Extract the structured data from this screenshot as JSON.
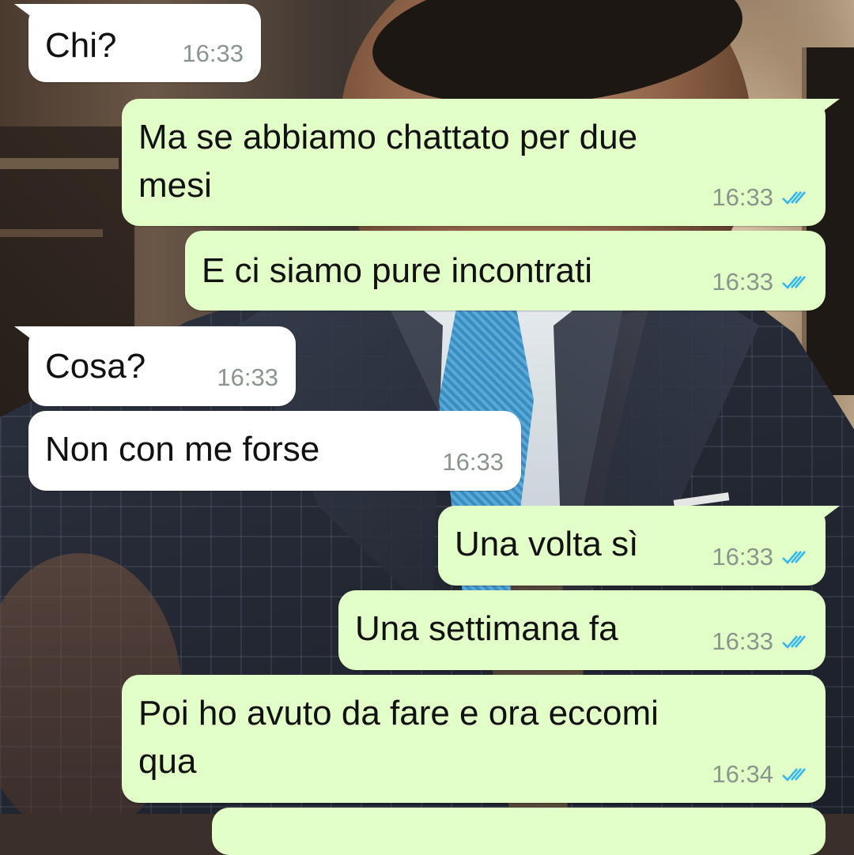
{
  "chat": {
    "messages": [
      {
        "direction": "incoming",
        "text": "Chi?",
        "time": "16:33"
      },
      {
        "direction": "outgoing",
        "text": "Ma se abbiamo chattato per due\nmesi",
        "time": "16:33",
        "status": "read-double-check-icon"
      },
      {
        "direction": "outgoing",
        "text": "E ci siamo pure incontrati",
        "time": "16:33",
        "status": "read-double-check-icon"
      },
      {
        "direction": "incoming",
        "text": "Cosa?",
        "time": "16:33"
      },
      {
        "direction": "incoming",
        "text": "Non con me forse",
        "time": "16:33"
      },
      {
        "direction": "outgoing",
        "text": "Una volta sì",
        "time": "16:33",
        "status": "read-double-check-icon"
      },
      {
        "direction": "outgoing",
        "text": "Una settimana fa",
        "time": "16:33",
        "status": "read-double-check-icon"
      },
      {
        "direction": "outgoing",
        "text": "Poi ho avuto da fare e ora eccomi\nqua",
        "time": "16:34",
        "status": "read-double-check-icon"
      }
    ]
  },
  "colors": {
    "incoming_bubble": "#ffffff",
    "outgoing_bubble": "#e2ffc8",
    "timestamp": "#8a968d",
    "read_ticks": "#34b7f1"
  },
  "wallpaper": "photo of a man in a dark checked suit with a blue tie"
}
